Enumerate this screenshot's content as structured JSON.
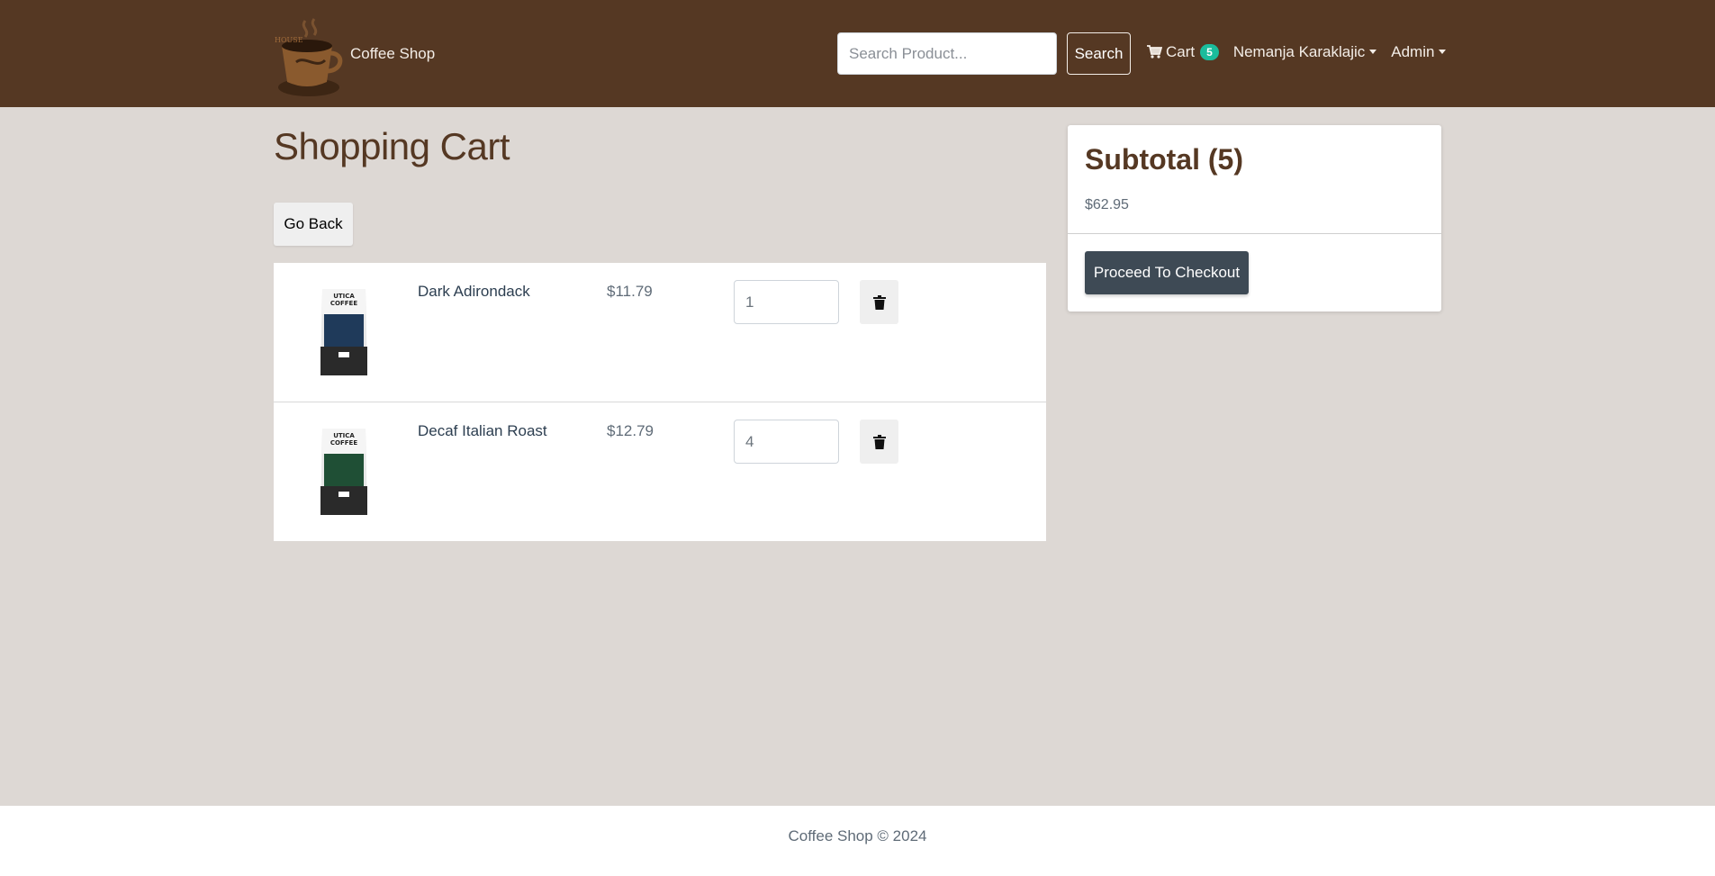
{
  "nav": {
    "brand": "Coffee Shop",
    "search_placeholder": "Search Product...",
    "search_label": "Search",
    "cart_label": "Cart",
    "cart_count": "5",
    "user_name": "Nemanja Karaklajic",
    "admin_label": "Admin"
  },
  "page": {
    "title": "Shopping Cart",
    "go_back": "Go Back"
  },
  "cart_items": [
    {
      "name": "Dark Adirondack",
      "price": "$11.79",
      "qty": "1",
      "label_color": "#1f3a5a"
    },
    {
      "name": "Decaf Italian Roast",
      "price": "$12.79",
      "qty": "4",
      "label_color": "#1f4f35"
    }
  ],
  "summary": {
    "title": "Subtotal (5)",
    "amount": "$62.95",
    "checkout_label": "Proceed To Checkout"
  },
  "footer": {
    "text": "Coffee Shop © 2024"
  },
  "colors": {
    "navbar": "#553823",
    "background": "#ddd8d4",
    "badge": "#1abc9c",
    "checkout": "#3e4a55"
  }
}
